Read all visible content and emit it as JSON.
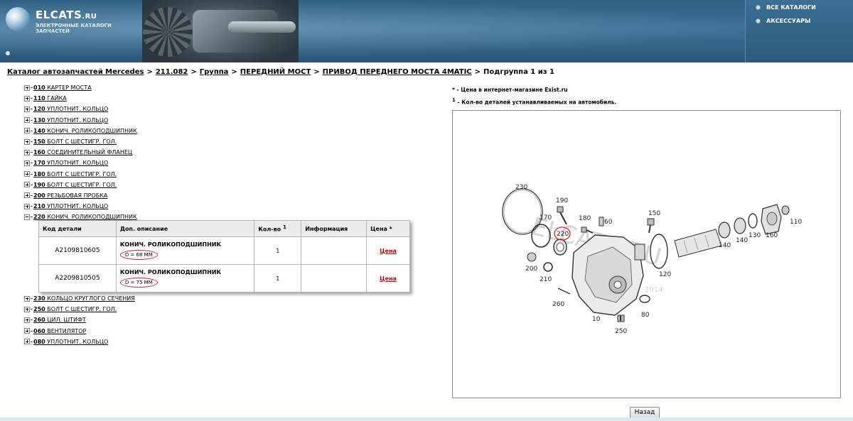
{
  "header": {
    "logo_title": "ELCATS",
    "logo_title_suffix": ".RU",
    "logo_subtitle": "ЭЛЕКТРОННЫЕ КАТАЛОГИ ЗАПЧАСТЕЙ",
    "nav": [
      "ВСЕ КАТАЛОГИ",
      "АКСЕССУАРЫ"
    ]
  },
  "breadcrumb": {
    "items": [
      "Каталог автозапчастей Mercedes",
      "211.082",
      "Группа",
      "ПЕРЕДНИЙ МОСТ",
      "ПРИВОД ПЕРЕДНЕГО МОСТА 4MATIC"
    ],
    "current": "Подгруппа 1 из 1",
    "separator": ">"
  },
  "tree": [
    {
      "code": "010",
      "name": "КАРТЕР МОСТА",
      "expanded": false
    },
    {
      "code": "110",
      "name": "ГАЙКА",
      "expanded": false
    },
    {
      "code": "120",
      "name": "УПЛОТНИТ. КОЛЬЦО",
      "expanded": false
    },
    {
      "code": "130",
      "name": "УПЛОТНИТ. КОЛЬЦО",
      "expanded": false
    },
    {
      "code": "140",
      "name": "КОНИЧ. РОЛИКОПОДШИПНИК",
      "expanded": false
    },
    {
      "code": "150",
      "name": "БОЛТ С ШЕСТИГР. ГОЛ.",
      "expanded": false
    },
    {
      "code": "160",
      "name": "СОЕДИНИТЕЛЬНЫЙ ФЛАНЕЦ",
      "expanded": false
    },
    {
      "code": "170",
      "name": "УПЛОТНИТ. КОЛЬЦО",
      "expanded": false
    },
    {
      "code": "180",
      "name": "БОЛТ С ШЕСТИГР. ГОЛ.",
      "expanded": false
    },
    {
      "code": "190",
      "name": "БОЛТ С ШЕСТИГР. ГОЛ.",
      "expanded": false
    },
    {
      "code": "200",
      "name": "РЕЗЬБОВАЯ ПРОБКА",
      "expanded": false
    },
    {
      "code": "210",
      "name": "УПЛОТНИТ. КОЛЬЦО",
      "expanded": false
    },
    {
      "code": "220",
      "name": "КОНИЧ. РОЛИКОПОДШИПНИК",
      "expanded": true
    }
  ],
  "tree_after": [
    {
      "code": "230",
      "name": "КОЛЬЦО КРУГЛОГО СЕЧЕНИЯ",
      "expanded": false
    },
    {
      "code": "250",
      "name": "БОЛТ С ШЕСТИГР. ГОЛ.",
      "expanded": false
    },
    {
      "code": "260",
      "name": "ЦИЛ. ШТИФТ",
      "expanded": false
    },
    {
      "code": "060",
      "name": "ВЕНТИЛЯТОР",
      "expanded": false
    },
    {
      "code": "080",
      "name": "УПЛОТНИТ. КОЛЬЦО",
      "expanded": false
    }
  ],
  "table": {
    "headers": {
      "code": "Код детали",
      "desc": "Доп. описание",
      "qty": "Кол-во",
      "qty_sup": "1",
      "info": "Информация",
      "price": "Цена *"
    },
    "rows": [
      {
        "code": "A2109810605",
        "title": "КОНИЧ. РОЛИКОПОДШИПНИК",
        "detail": "D = 68 MM",
        "qty": "1",
        "info": "",
        "price": "Цена"
      },
      {
        "code": "A2209810505",
        "title": "КОНИЧ. РОЛИКОПОДШИПНИК",
        "detail": "D = 75 MM",
        "qty": "1",
        "info": "",
        "price": "Цена"
      }
    ]
  },
  "notes": {
    "price_mark": "*",
    "price_text": " - Цена в интернет-магазине Exist.ru",
    "qty_mark": "1",
    "qty_text": " - Кол-во деталей устанавливаемых на автомобиль."
  },
  "diagram": {
    "callouts": [
      "230",
      "190",
      "170",
      "180",
      "60",
      "150",
      "220",
      "200",
      "210",
      "120",
      "140",
      "140",
      "130",
      "160",
      "110",
      "260",
      "10",
      "80",
      "250"
    ],
    "watermark": "ELCATS.RU",
    "watermark_year": "2014"
  },
  "back_button": "Назад",
  "colors": {
    "header": "#2f5f82",
    "price_link": "#cc0000",
    "highlight_circle": "#dd2222"
  }
}
